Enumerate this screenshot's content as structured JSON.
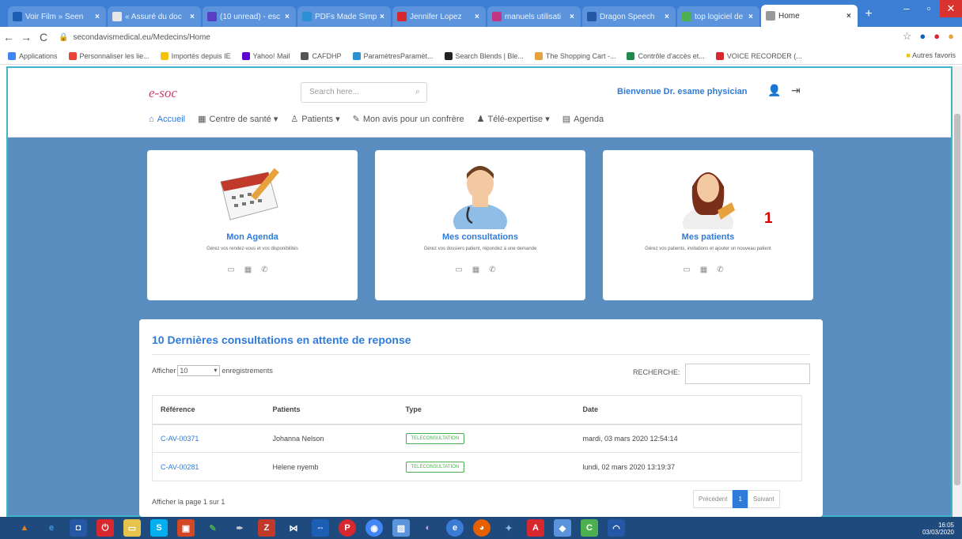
{
  "browser": {
    "tabs": [
      {
        "title": "Voir Film » Seen",
        "color": "#1b5fb5"
      },
      {
        "title": "« Assuré du doc",
        "color": "#e6e6e6"
      },
      {
        "title": "(10 unread) - esc",
        "color": "#5b3cc4"
      },
      {
        "title": "PDFs Made Simp",
        "color": "#2a8fd4"
      },
      {
        "title": "Jennifer Lopez",
        "color": "#d8282f"
      },
      {
        "title": "manuels utilisati",
        "color": "#c13584"
      },
      {
        "title": "Dragon Speech",
        "color": "#2458a6"
      },
      {
        "title": "top logiciel de",
        "color": "#4caf50"
      },
      {
        "title": "Home",
        "color": "#999999"
      }
    ],
    "url": "secondavismedical.eu/Medecins/Home",
    "bookmarks": [
      {
        "label": "Applications",
        "color": "#4285f4"
      },
      {
        "label": "Personnaliser les lie...",
        "color": "#ea4335"
      },
      {
        "label": "Importés depuis IE",
        "color": "#f4c20d"
      },
      {
        "label": "Yahoo! Mail",
        "color": "#5f01d1"
      },
      {
        "label": "CAFDHP",
        "color": "#555555"
      },
      {
        "label": "ParamètresParamèt...",
        "color": "#2a8fd4"
      },
      {
        "label": "Search Blends | Ble...",
        "color": "#222222"
      },
      {
        "label": "The Shopping Cart -...",
        "color": "#e6a23c"
      },
      {
        "label": "Contrôle d'accès et...",
        "color": "#1f8a4c"
      },
      {
        "label": "VOICE RECORDER (...",
        "color": "#d8282f"
      }
    ],
    "bookmarks_other": "Autres favoris"
  },
  "app": {
    "logo": "e-soc",
    "search_placeholder": "Search here...",
    "welcome": "Bienvenue Dr. esame physician",
    "menu": [
      {
        "label": "Accueil",
        "icon": "home-icon"
      },
      {
        "label": "Centre de santé ▾",
        "icon": "building-icon"
      },
      {
        "label": "Patients ▾",
        "icon": "user-icon"
      },
      {
        "label": "Mon avis pour un confrère",
        "icon": "edit-icon"
      },
      {
        "label": "Télé-expertise ▾",
        "icon": "person-icon"
      },
      {
        "label": "Agenda",
        "icon": "calendar-icon"
      }
    ]
  },
  "cards": [
    {
      "title": "Mon Agenda",
      "desc": "Gérez vos rendez-vous et vos disponibilités"
    },
    {
      "title": "Mes consultations",
      "desc": "Gérez vos dossiers patient, répondez à une demande"
    },
    {
      "title": "Mes patients",
      "desc": "Gérez vos patients, invitations et ajouter un nouveau patient"
    }
  ],
  "marker": "1",
  "panel": {
    "title": "10 Dernières consultations en attente de reponse",
    "show_prefix": "Afficher",
    "show_value": "10",
    "show_suffix": "enregistrements",
    "search_label": "RECHERCHE:",
    "columns": [
      "Référence",
      "Patients",
      "Type",
      "Date"
    ],
    "rows": [
      {
        "ref": "C-AV-00371",
        "patient": "Johanna Nelson",
        "type": "TELECONSULTATION",
        "date": "mardi, 03 mars 2020 12:54:14"
      },
      {
        "ref": "C-AV-00281",
        "patient": "Helene nyemb",
        "type": "TELECONSULTATION",
        "date": "lundi, 02 mars 2020 13:19:37"
      }
    ],
    "page_info": "Afficher la page 1 sur 1",
    "prev": "Précédent",
    "current_page": "1",
    "next": "Suivant"
  },
  "taskbar": {
    "clock_time": "16:05",
    "clock_date": "03/03/2020"
  }
}
